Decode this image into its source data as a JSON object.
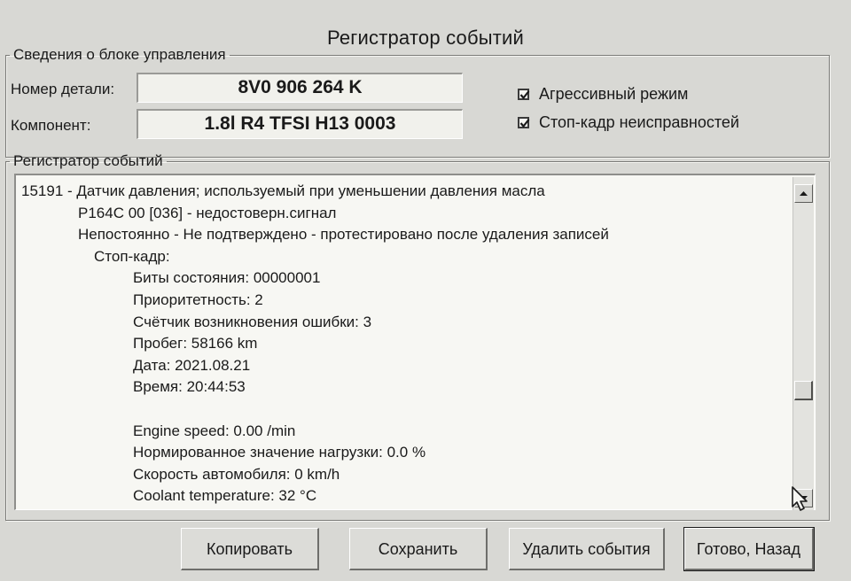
{
  "window": {
    "title": "Регистратор событий"
  },
  "ecu_info": {
    "legend": "Сведения о блоке управления",
    "part_number_label": "Номер детали:",
    "part_number_value": "8V0 906 264 K",
    "component_label": "Компонент:",
    "component_value": "1.8l R4 TFSI  H13 0003",
    "aggressive_mode": {
      "label": "Агрессивный режим",
      "checked": true
    },
    "freeze_frame": {
      "label": "Стоп-кадр неисправностей",
      "checked": true
    }
  },
  "event_log": {
    "legend": "Регистратор событий",
    "lines": [
      {
        "text": "15191 - Датчик давления; используемый при уменьшении давления масла",
        "indent": 0
      },
      {
        "text": "P164C 00 [036] - недостоверн.сигнал",
        "indent": 1
      },
      {
        "text": "Непостоянно - Не подтверждено - протестировано после удаления записей",
        "indent": 1
      },
      {
        "text": "Стоп-кадр:",
        "indent": 2
      },
      {
        "text": "Биты состояния: 00000001",
        "indent": 3
      },
      {
        "text": "Приоритетность: 2",
        "indent": 3
      },
      {
        "text": "Счётчик возникновения ошибки: 3",
        "indent": 3
      },
      {
        "text": "Пробег: 58166 km",
        "indent": 3
      },
      {
        "text": "Дата: 2021.08.21",
        "indent": 3
      },
      {
        "text": "Время: 20:44:53",
        "indent": 3
      },
      {
        "text": "",
        "indent": 3
      },
      {
        "text": "Engine speed: 0.00 /min",
        "indent": 3
      },
      {
        "text": "Нормированное значение нагрузки: 0.0 %",
        "indent": 3
      },
      {
        "text": "Скорость автомобиля: 0 km/h",
        "indent": 3
      },
      {
        "text": "Coolant temperature: 32 °C",
        "indent": 3
      }
    ],
    "scroll_position": 0.64
  },
  "buttons": {
    "copy": "Копировать",
    "save": "Сохранить",
    "delete_events": "Удалить события",
    "done_back": "Готово, Назад"
  }
}
